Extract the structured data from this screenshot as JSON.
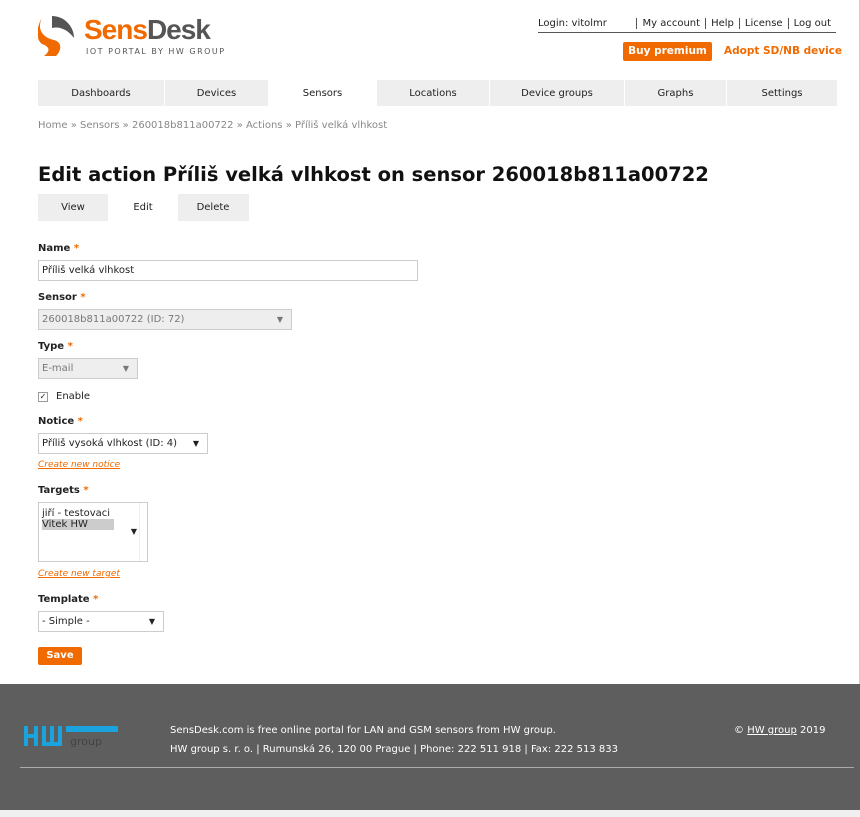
{
  "header": {
    "brand_a": "Sens",
    "brand_b": "Desk",
    "tagline": "IOT PORTAL BY HW GROUP",
    "login": "Login: vitolmr",
    "links": [
      "My account",
      "Help",
      "License",
      "Log out"
    ],
    "buy": "Buy premium",
    "adopt": "Adopt SD/NB device"
  },
  "nav": [
    "Dashboards",
    "Devices",
    "Sensors",
    "Locations",
    "Device groups",
    "Graphs",
    "Settings"
  ],
  "breadcrumb": "Home » Sensors » 260018b811a00722 » Actions » Příliš velká vlhkost",
  "title": "Edit action Příliš velká vlhkost on sensor 260018b811a00722",
  "tabs": [
    "View",
    "Edit",
    "Delete"
  ],
  "form": {
    "name_label": "Name",
    "name_value": "Příliš velká vlhkost",
    "sensor_label": "Sensor",
    "sensor_value": "260018b811a00722 (ID: 72)",
    "type_label": "Type",
    "type_value": "E-mail",
    "enable_label": "Enable",
    "notice_label": "Notice",
    "notice_value": "Příliš vysoká vlhkost (ID: 4)",
    "create_notice": "Create new notice",
    "targets_label": "Targets",
    "targets": [
      "jiří - testovaci",
      "Vitek HW"
    ],
    "create_target": "Create new target",
    "template_label": "Template",
    "template_value": "- Simple -",
    "required": "*",
    "save": "Save"
  },
  "footer": {
    "line1": "SensDesk.com is free online portal for LAN and GSM sensors from HW group.",
    "line2": "HW group s. r. o. | Rumunská 26, 120 00 Prague | Phone: 222 511 918 | Fax: 222 513 833",
    "copy": "©",
    "copy_link": "HW group",
    "year": "2019",
    "logo": "HW group"
  },
  "colors": {
    "accent": "#f06a00",
    "footer": "#5e5e5e",
    "hw_blue": "#1aa3dc"
  }
}
